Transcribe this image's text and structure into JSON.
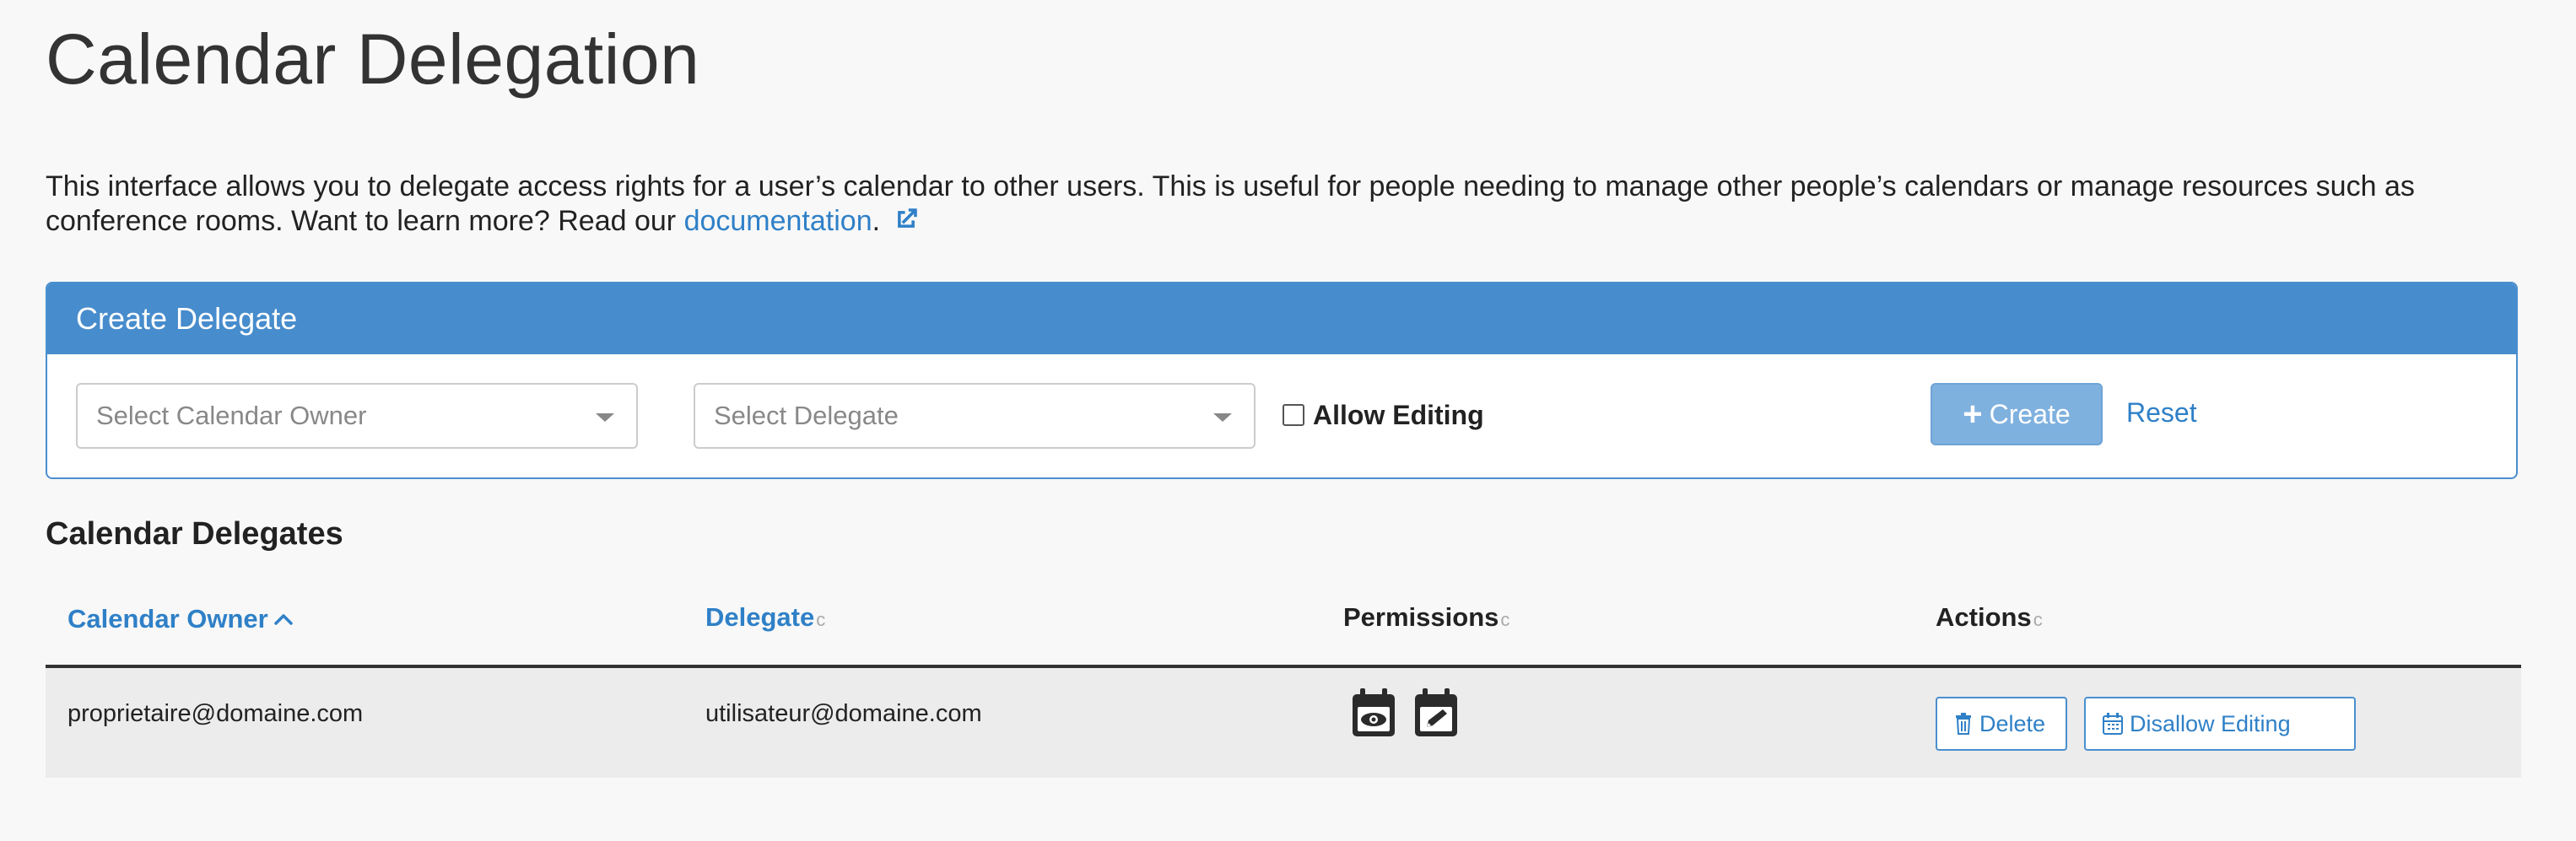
{
  "page": {
    "title": "Calendar Delegation",
    "intro_text": "This interface allows you to delegate access rights for a user’s calendar to other users. This is useful for people needing to manage other people’s calendars or manage resources such as conference rooms. Want to learn more? Read our ",
    "intro_link": "documentation",
    "intro_end": ".",
    "external_link_icon": "external-link-icon"
  },
  "create_panel": {
    "title": "Create Delegate",
    "owner_placeholder": "Select Calendar Owner",
    "delegate_placeholder": "Select Delegate",
    "allow_editing_label": "Allow Editing",
    "allow_editing_checked": false,
    "create_label": "Create",
    "create_icon": "plus-icon",
    "reset_label": "Reset"
  },
  "delegates": {
    "title": "Calendar Delegates",
    "columns": {
      "owner": "Calendar Owner",
      "delegate": "Delegate",
      "permissions": "Permissions",
      "actions": "Actions"
    },
    "sort_mark": "c",
    "rows": [
      {
        "owner": "proprietaire@domaine.com",
        "delegate": "utilisateur@domaine.com",
        "permission_icons": [
          "calendar-view-icon",
          "calendar-edit-icon"
        ],
        "delete_label": "Delete",
        "disallow_label": "Disallow Editing"
      }
    ]
  },
  "colors": {
    "accent": "#2f80c7",
    "panel_header": "#478ccc",
    "create_button": "#7fb1df",
    "row_background": "#ececec"
  }
}
